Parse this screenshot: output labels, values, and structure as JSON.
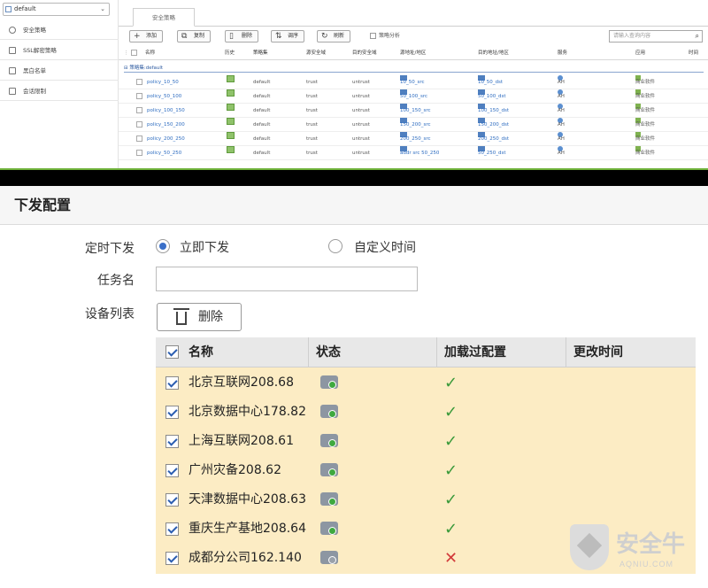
{
  "top_panel": {
    "sidebar": {
      "dropdown_value": "default",
      "items": [
        {
          "label": "安全策略",
          "icon": "bulb-icon"
        },
        {
          "label": "SSL解密策略",
          "icon": "ssl-icon"
        },
        {
          "label": "黑白名单",
          "icon": "list-icon"
        },
        {
          "label": "会话限制",
          "icon": "session-icon"
        }
      ]
    },
    "tab_label": "安全策略",
    "toolbar": {
      "add": "添加",
      "copy": "复制",
      "delete": "删除",
      "order": "调序",
      "refresh": "刷新",
      "analysis": "策略分析",
      "search_placeholder": "请输入查询内容"
    },
    "columns": [
      "名称",
      "历史",
      "策略集",
      "源安全域",
      "目的安全域",
      "源地址/地区",
      "目的地址/地区",
      "服务",
      "应用",
      "时间"
    ],
    "group_label": "策略集:default",
    "rows": [
      {
        "name": "policy_10_50",
        "set": "default",
        "src_zone": "trust",
        "dst_zone": "untrust",
        "src": "10_50_src",
        "dst": "10_50_dst",
        "service": "AH",
        "app": "商业软件"
      },
      {
        "name": "policy_50_100",
        "set": "default",
        "src_zone": "trust",
        "dst_zone": "untrust",
        "src": "50_100_src",
        "dst": "50_100_dst",
        "service": "AH",
        "app": "商业软件"
      },
      {
        "name": "policy_100_150",
        "set": "default",
        "src_zone": "trust",
        "dst_zone": "untrust",
        "src": "100_150_src",
        "dst": "100_150_dst",
        "service": "AH",
        "app": "商业软件"
      },
      {
        "name": "policy_150_200",
        "set": "default",
        "src_zone": "trust",
        "dst_zone": "untrust",
        "src": "150_200_src",
        "dst": "150_200_dst",
        "service": "AH",
        "app": "商业软件"
      },
      {
        "name": "policy_200_250",
        "set": "default",
        "src_zone": "trust",
        "dst_zone": "untrust",
        "src": "200_250_src",
        "dst": "200_250_dst",
        "service": "AH",
        "app": "商业软件"
      },
      {
        "name": "policy_50_250",
        "set": "default",
        "src_zone": "trust",
        "dst_zone": "untrust",
        "src": "addr src 50_250",
        "dst": "50_250_dst",
        "service": "AH",
        "app": "商业软件"
      }
    ]
  },
  "deploy": {
    "title": "下发配置",
    "schedule_label": "定时下发",
    "option_now": "立即下发",
    "option_custom": "自定义时间",
    "task_label": "任务名",
    "task_value": "",
    "device_label": "设备列表",
    "delete_button": "删除",
    "columns": [
      "名称",
      "状态",
      "加载过配置",
      "更改时间"
    ],
    "devices": [
      {
        "name": "北京互联网208.68",
        "status_color": "#3fa93f",
        "loaded": "✓"
      },
      {
        "name": "北京数据中心178.82",
        "status_color": "#3fa93f",
        "loaded": "✓"
      },
      {
        "name": "上海互联网208.61",
        "status_color": "#3fa93f",
        "loaded": "✓"
      },
      {
        "name": "广州灾备208.62",
        "status_color": "#3fa93f",
        "loaded": "✓"
      },
      {
        "name": "天津数据中心208.63",
        "status_color": "#3fa93f",
        "loaded": "✓"
      },
      {
        "name": "重庆生产基地208.64",
        "status_color": "#3fa93f",
        "loaded": "✓"
      },
      {
        "name": "成都分公司162.140",
        "status_color": "#9aa1aa",
        "loaded": "✕"
      }
    ]
  },
  "watermark": {
    "text": "安全牛",
    "sub": "AQNIU.COM"
  }
}
